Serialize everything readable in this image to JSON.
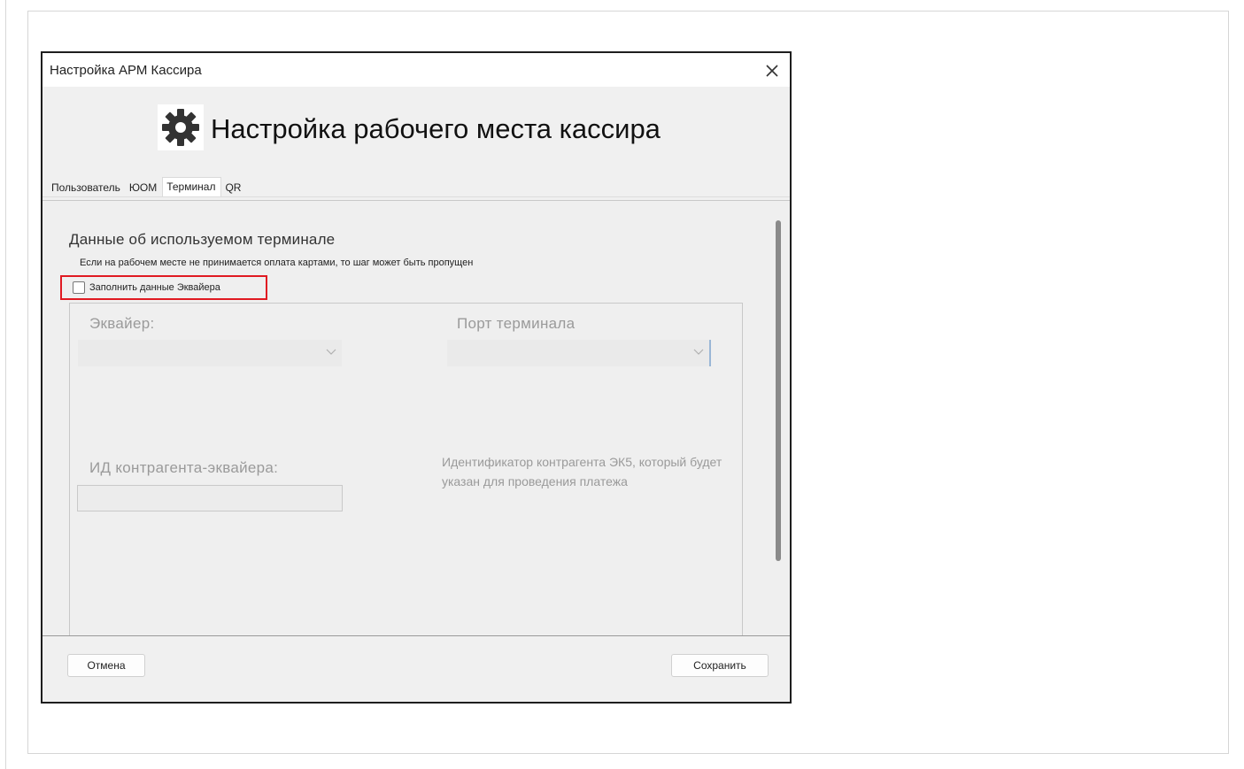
{
  "window": {
    "title": "Настройка АРМ Кассира"
  },
  "header": {
    "title": "Настройка рабочего места кассира",
    "icon": "gear-icon"
  },
  "tabs": [
    {
      "label": "Пользователь",
      "active": false
    },
    {
      "label": "ЮОМ",
      "active": false
    },
    {
      "label": "Терминал",
      "active": true
    },
    {
      "label": "QR",
      "active": false
    }
  ],
  "terminal": {
    "section_title": "Данные об используемом терминале",
    "hint": "Если на рабочем месте не принимается оплата картами, то шаг может быть пропущен",
    "fill_acquirer_checkbox": {
      "label": "Заполнить данные Эквайера",
      "checked": false
    },
    "acquirer_label": "Эквайер:",
    "acquirer_value": "",
    "port_label": "Порт терминала",
    "port_value": "",
    "counterparty_label": "ИД контрагента-эквайера:",
    "counterparty_value": "",
    "counterparty_help": "Идентификатор контрагента ЭК5, который будет указан для проведения платежа"
  },
  "footer": {
    "cancel_label": "Отмена",
    "save_label": "Сохранить"
  },
  "colors": {
    "highlight": "#e01a22",
    "dialog_bg": "#f0f0f0",
    "disabled_text": "#9a9a9a"
  }
}
